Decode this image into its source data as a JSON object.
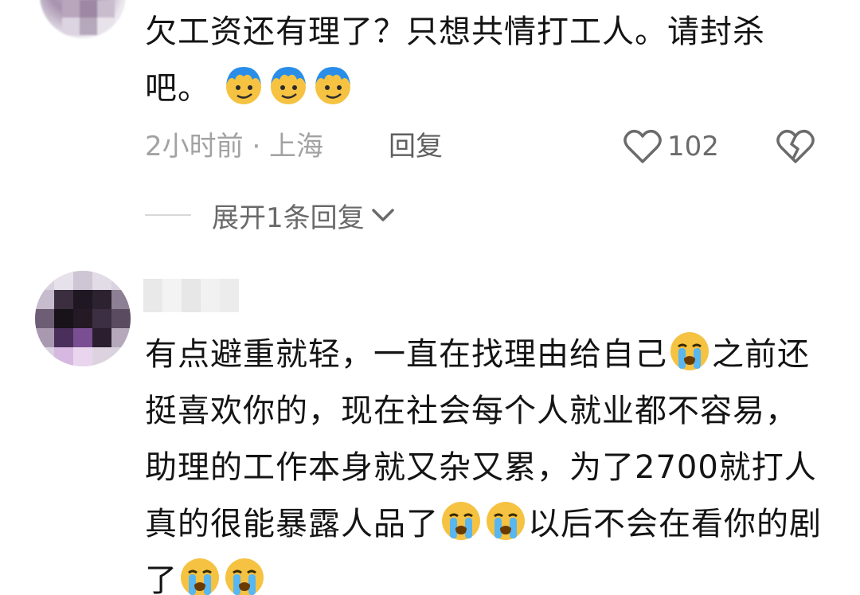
{
  "comments": [
    {
      "text_before": "欠工资还有理了？只想共情打工人。请封杀吧。",
      "emojis": [
        "smirk-face-emoji",
        "smirk-face-emoji",
        "smirk-face-emoji"
      ],
      "time_location": "2小时前 · 上海",
      "reply_label": "回复",
      "like_count": "102",
      "expand_label": "展开1条回复"
    },
    {
      "segments": [
        "有点避重就轻，一直在找理由给自己",
        "之前还挺喜欢你的，现在社会每个人就业都不容易，助理的工作本身就又杂又累，为了2700就打人真的很能暴露人品了",
        "以后不会在看你的剧了"
      ]
    }
  ],
  "icons": {
    "like": "heart-outline-icon",
    "dislike": "broken-heart-icon",
    "expand": "chevron-down-icon",
    "crying": "loudly-crying-face-emoji"
  },
  "colors": {
    "text": "#141414",
    "meta": "#a2a2a2",
    "emoji_blue": "#2a8ee8",
    "emoji_yellow": "#f5c242"
  }
}
